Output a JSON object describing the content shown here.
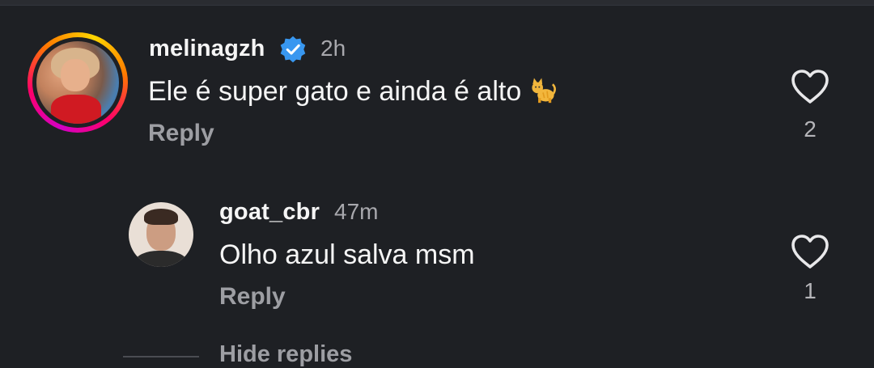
{
  "comments": [
    {
      "username": "melinagzh",
      "verified": true,
      "time": "2h",
      "text": "Ele é super gato e ainda é alto",
      "emoji": "cat-emoji",
      "reply_label": "Reply",
      "likes": "2",
      "avatar_ring": "story-gradient"
    },
    {
      "username": "goat_cbr",
      "verified": false,
      "time": "47m",
      "text": "Olho azul salva msm",
      "reply_label": "Reply",
      "likes": "1"
    }
  ],
  "hide_replies_label": "Hide replies",
  "icons": {
    "verified": "verified-badge-icon",
    "like": "heart-outline-icon"
  },
  "colors": {
    "background": "#1e2024",
    "verified_blue": "#3897f0",
    "muted_text": "#9d9ea3"
  }
}
